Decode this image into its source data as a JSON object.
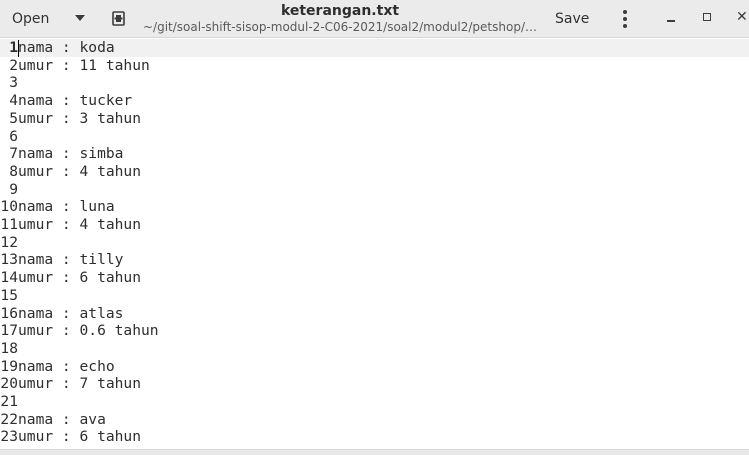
{
  "header": {
    "open_label": "Open",
    "title": "keterangan.txt",
    "path": "~/git/soal-shift-sisop-modul-2-C06-2021/soal2/modul2/petshop/…",
    "save_label": "Save",
    "close_glyph": "✕"
  },
  "editor": {
    "lines": [
      {
        "num": "1",
        "text": "nama : koda"
      },
      {
        "num": "2",
        "text": "umur : 11 tahun"
      },
      {
        "num": "3",
        "text": ""
      },
      {
        "num": "4",
        "text": "nama : tucker"
      },
      {
        "num": "5",
        "text": "umur : 3 tahun"
      },
      {
        "num": "6",
        "text": ""
      },
      {
        "num": "7",
        "text": "nama : simba"
      },
      {
        "num": "8",
        "text": "umur : 4 tahun"
      },
      {
        "num": "9",
        "text": ""
      },
      {
        "num": "10",
        "text": "nama : luna"
      },
      {
        "num": "11",
        "text": "umur : 4 tahun"
      },
      {
        "num": "12",
        "text": ""
      },
      {
        "num": "13",
        "text": "nama : tilly"
      },
      {
        "num": "14",
        "text": "umur : 6 tahun"
      },
      {
        "num": "15",
        "text": ""
      },
      {
        "num": "16",
        "text": "nama : atlas"
      },
      {
        "num": "17",
        "text": "umur : 0.6 tahun"
      },
      {
        "num": "18",
        "text": ""
      },
      {
        "num": "19",
        "text": "nama : echo"
      },
      {
        "num": "20",
        "text": "umur : 7 tahun"
      },
      {
        "num": "21",
        "text": ""
      },
      {
        "num": "22",
        "text": "nama : ava"
      },
      {
        "num": "23",
        "text": "umur : 6 tahun"
      }
    ]
  }
}
